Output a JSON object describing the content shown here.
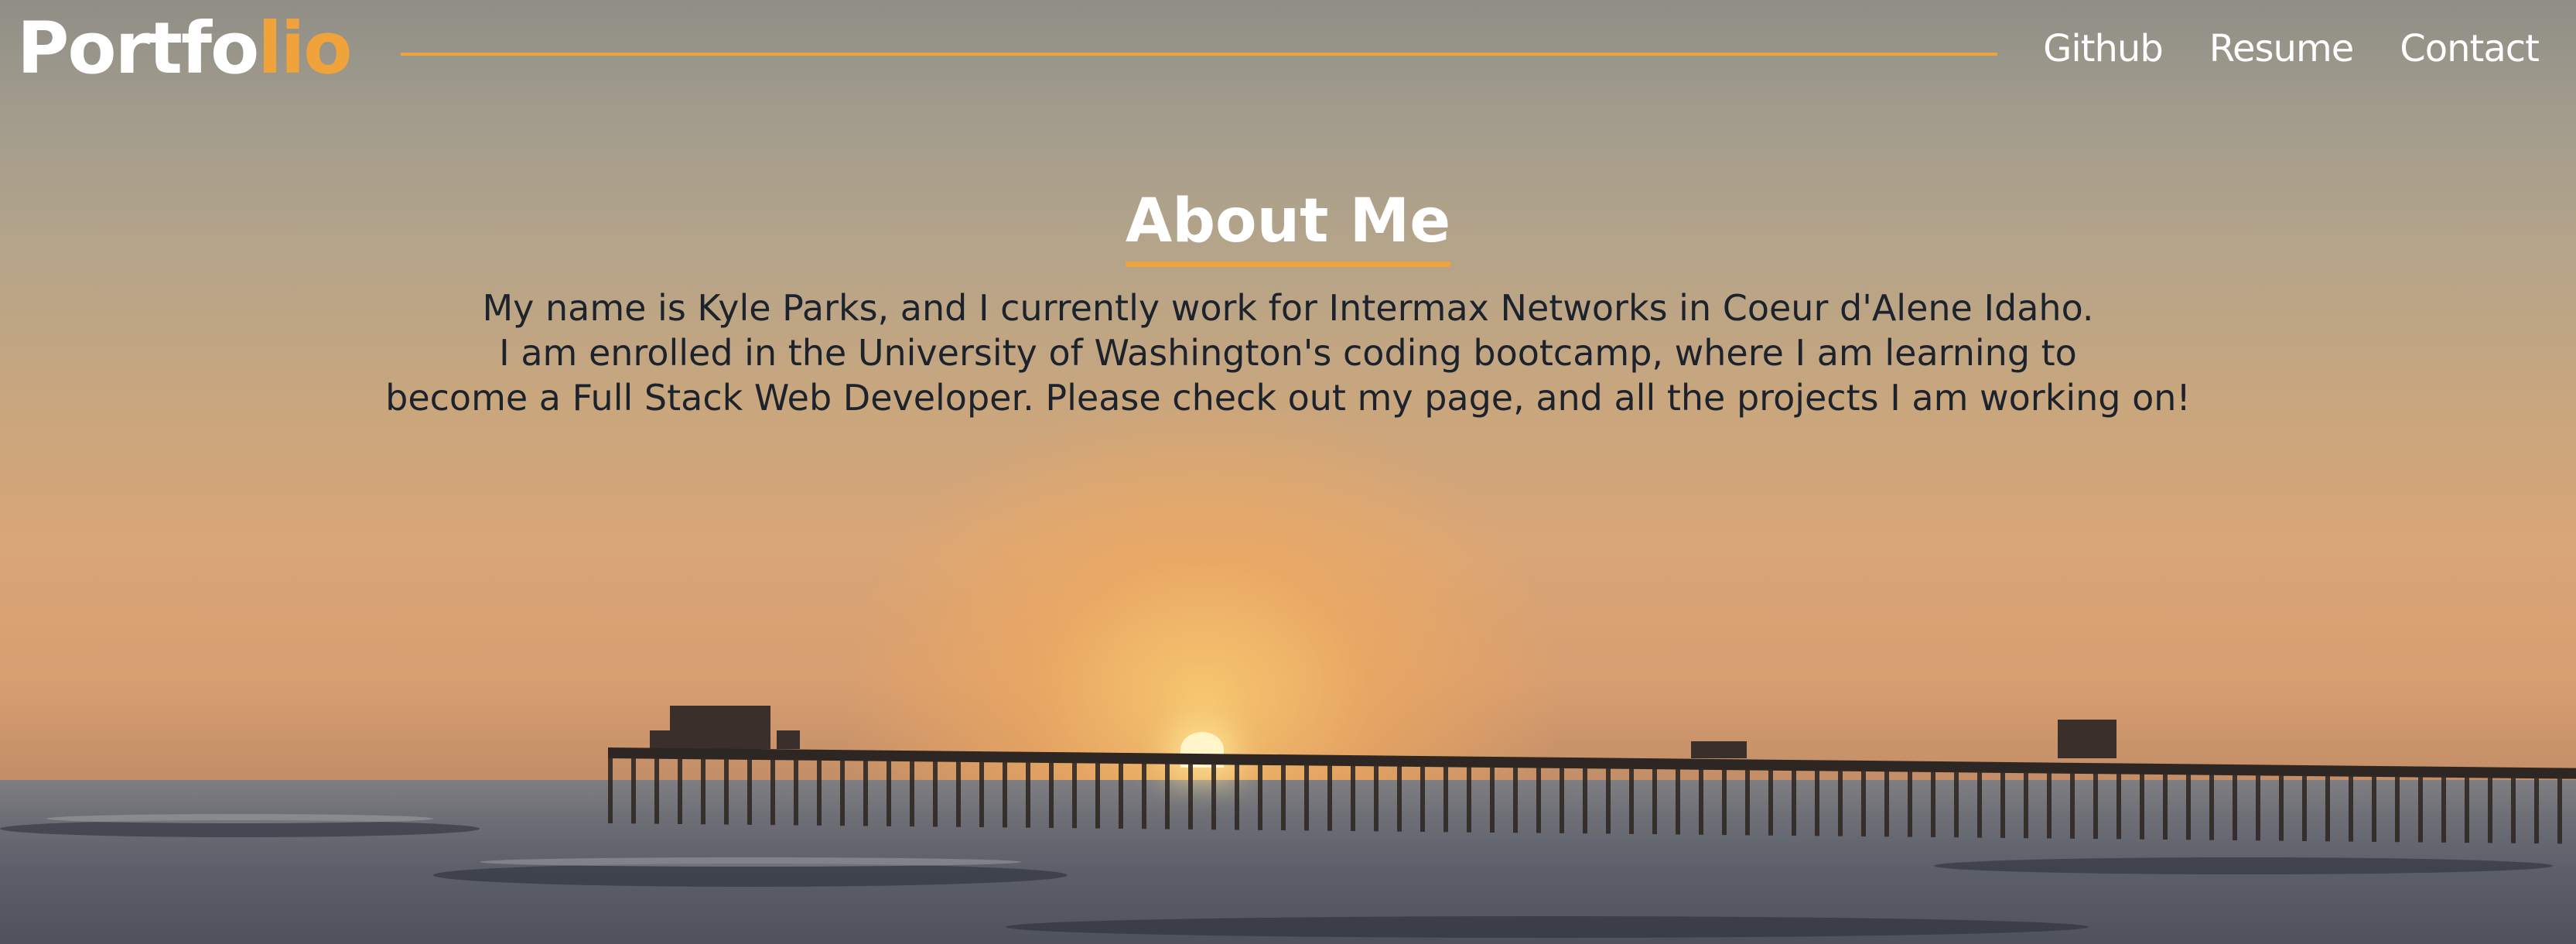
{
  "header": {
    "logo_main": "Portfo",
    "logo_accent": "lio",
    "nav": [
      {
        "label": "Github"
      },
      {
        "label": "Resume"
      },
      {
        "label": "Contact"
      }
    ]
  },
  "about": {
    "title": "About Me",
    "lines": [
      "My name is Kyle Parks, and I currently work for Intermax Networks in Coeur d'Alene Idaho.",
      "I am enrolled in the University of Washington's coding bootcamp, where I am learning to",
      "become a Full Stack Web Developer. Please check out my page, and all the projects I am working on!"
    ]
  },
  "colors": {
    "accent": "#f0a33a",
    "heading": "#ffffff",
    "body_text": "#1d232c"
  },
  "background": {
    "image": "sunset-over-pier-photo"
  }
}
